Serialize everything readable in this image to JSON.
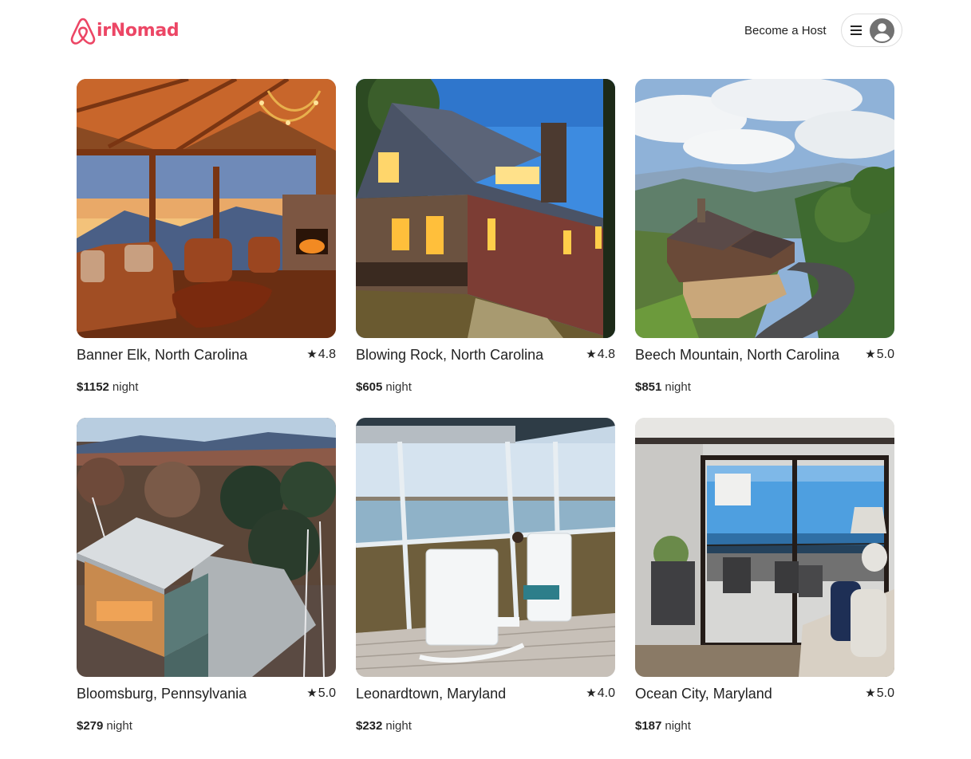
{
  "brand": {
    "name": "irNomad",
    "color": "#ec4665"
  },
  "header": {
    "host_label": "Become a Host",
    "menu_icon": "hamburger-icon",
    "avatar_icon": "user-avatar-icon"
  },
  "listings": [
    {
      "location": "Banner Elk, North Carolina",
      "rating": "4.8",
      "price": "$1152",
      "unit": "night",
      "photo": "mountain-lodge-interior"
    },
    {
      "location": "Blowing Rock, North Carolina",
      "rating": "4.8",
      "price": "$605",
      "unit": "night",
      "photo": "stone-cabin-exterior"
    },
    {
      "location": "Beech Mountain, North Carolina",
      "rating": "5.0",
      "price": "$851",
      "unit": "night",
      "photo": "mountain-house-aerial"
    },
    {
      "location": "Bloomsburg, Pennsylvania",
      "rating": "5.0",
      "price": "$279",
      "unit": "night",
      "photo": "forest-treehouse-aerial"
    },
    {
      "location": "Leonardtown, Maryland",
      "rating": "4.0",
      "price": "$232",
      "unit": "night",
      "photo": "screened-porch-water-view"
    },
    {
      "location": "Ocean City, Maryland",
      "rating": "5.0",
      "price": "$187",
      "unit": "night",
      "photo": "condo-living-room-ocean-view"
    }
  ],
  "rating_icon": "star-icon"
}
